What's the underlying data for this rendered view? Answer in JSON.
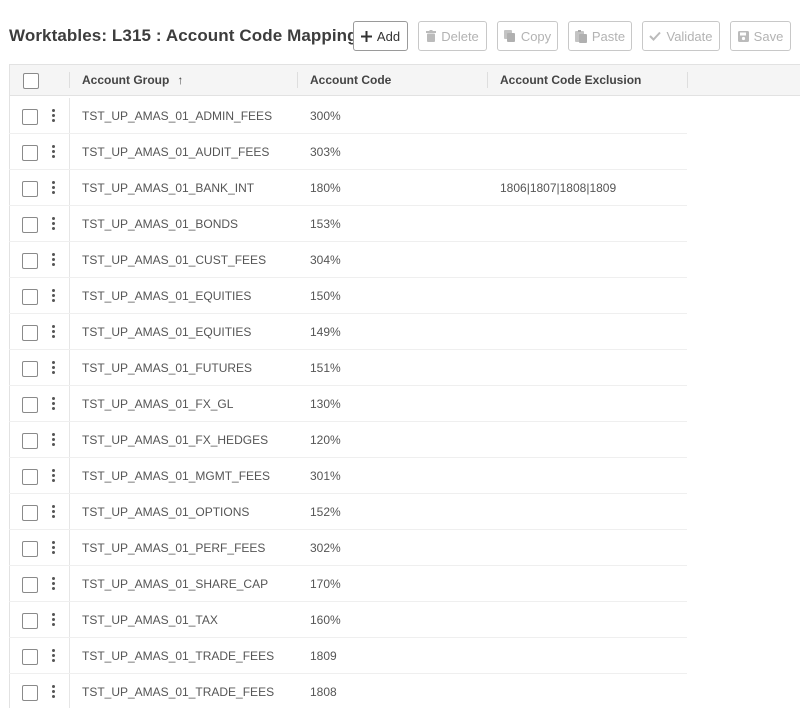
{
  "page": {
    "title": "Worktables: L315 : Account Code Mapping"
  },
  "toolbar": {
    "add_label": "Add",
    "delete_label": "Delete",
    "copy_label": "Copy",
    "paste_label": "Paste",
    "validate_label": "Validate",
    "save_label": "Save"
  },
  "grid": {
    "columns": [
      "Account Group",
      "Account Code",
      "Account Code Exclusion"
    ],
    "sort_indicator": "↑",
    "rows": [
      {
        "group": "TST_UP_AMAS_01_ADMIN_FEES",
        "code": "300%",
        "exclusion": ""
      },
      {
        "group": "TST_UP_AMAS_01_AUDIT_FEES",
        "code": "303%",
        "exclusion": ""
      },
      {
        "group": "TST_UP_AMAS_01_BANK_INT",
        "code": "180%",
        "exclusion": "1806|1807|1808|1809"
      },
      {
        "group": "TST_UP_AMAS_01_BONDS",
        "code": "153%",
        "exclusion": ""
      },
      {
        "group": "TST_UP_AMAS_01_CUST_FEES",
        "code": "304%",
        "exclusion": ""
      },
      {
        "group": "TST_UP_AMAS_01_EQUITIES",
        "code": "150%",
        "exclusion": ""
      },
      {
        "group": "TST_UP_AMAS_01_EQUITIES",
        "code": "149%",
        "exclusion": ""
      },
      {
        "group": "TST_UP_AMAS_01_FUTURES",
        "code": "151%",
        "exclusion": ""
      },
      {
        "group": "TST_UP_AMAS_01_FX_GL",
        "code": "130%",
        "exclusion": ""
      },
      {
        "group": "TST_UP_AMAS_01_FX_HEDGES",
        "code": "120%",
        "exclusion": ""
      },
      {
        "group": "TST_UP_AMAS_01_MGMT_FEES",
        "code": "301%",
        "exclusion": ""
      },
      {
        "group": "TST_UP_AMAS_01_OPTIONS",
        "code": "152%",
        "exclusion": ""
      },
      {
        "group": "TST_UP_AMAS_01_PERF_FEES",
        "code": "302%",
        "exclusion": ""
      },
      {
        "group": "TST_UP_AMAS_01_SHARE_CAP",
        "code": "170%",
        "exclusion": ""
      },
      {
        "group": "TST_UP_AMAS_01_TAX",
        "code": "160%",
        "exclusion": ""
      },
      {
        "group": "TST_UP_AMAS_01_TRADE_FEES",
        "code": "1809",
        "exclusion": ""
      },
      {
        "group": "TST_UP_AMAS_01_TRADE_FEES",
        "code": "1808",
        "exclusion": ""
      }
    ]
  }
}
